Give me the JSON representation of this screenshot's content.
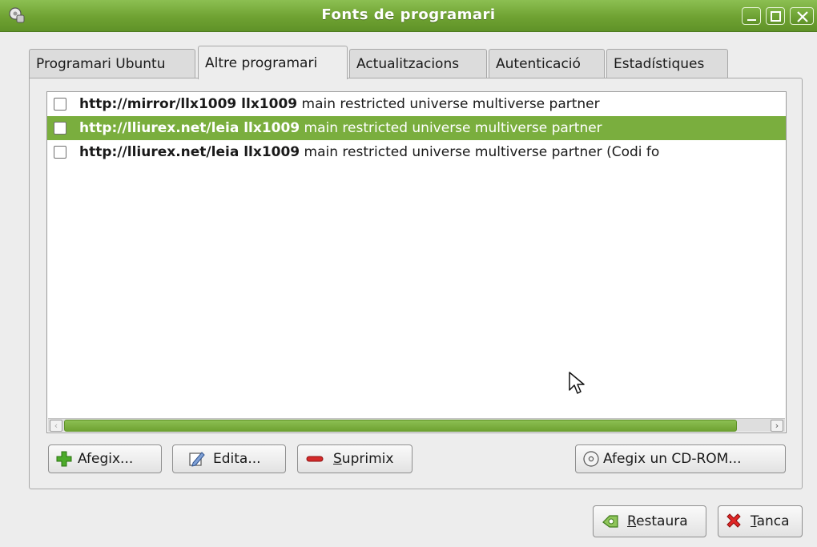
{
  "window": {
    "title": "Fonts de programari",
    "icon": "software-sources-icon",
    "controls": [
      "minimize-icon",
      "maximize-icon",
      "close-icon"
    ]
  },
  "tabs": [
    {
      "label": "Programari Ubuntu",
      "active": false
    },
    {
      "label": "Altre programari",
      "active": true
    },
    {
      "label": "Actualitzacions",
      "active": false
    },
    {
      "label": "Autenticació",
      "active": false
    },
    {
      "label": "Estadístiques",
      "active": false
    }
  ],
  "sources": [
    {
      "checked": false,
      "selected": false,
      "bold": "http://mirror/llx1009 llx1009",
      "rest": " main restricted universe multiverse partner"
    },
    {
      "checked": false,
      "selected": true,
      "bold": "http://lliurex.net/leia llx1009",
      "rest": " main restricted universe multiverse partner"
    },
    {
      "checked": false,
      "selected": false,
      "bold": "http://lliurex.net/leia llx1009",
      "rest": " main restricted universe multiverse partner (Codi fo"
    }
  ],
  "buttons": {
    "add": {
      "label": "Afegix...",
      "icon": "plus-icon"
    },
    "edit": {
      "label": "Edita...",
      "icon": "edit-icon"
    },
    "remove": {
      "mnemonic": "S",
      "rest": "uprimix",
      "icon": "minus-icon"
    },
    "add_cdrom": {
      "label": "Afegix un CD-ROM...",
      "icon": "cdrom-icon"
    },
    "revert": {
      "mnemonic": "R",
      "rest": "estaura",
      "icon": "revert-icon"
    },
    "close": {
      "mnemonic": "T",
      "rest": "anca",
      "icon": "close-x-icon"
    }
  },
  "colors": {
    "accent": "#7aae3e",
    "titlebar": "#6fa232",
    "remove_icon": "#d42a2a"
  }
}
